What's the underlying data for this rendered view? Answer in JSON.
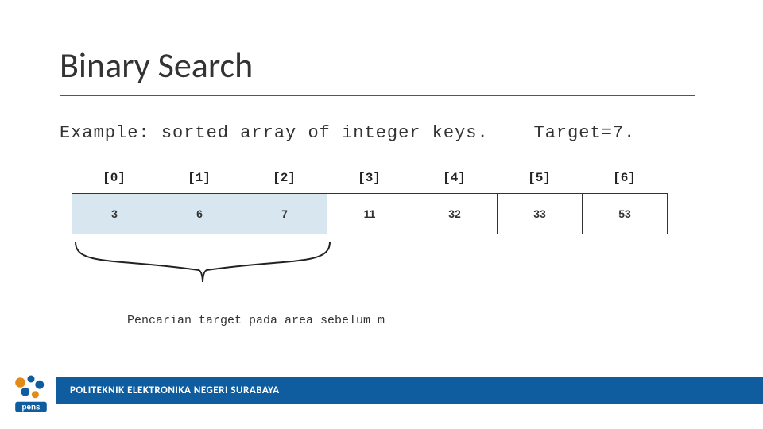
{
  "title": "Binary Search",
  "subtitle_prefix": "Example: sorted array of integer keys.",
  "subtitle_target": "Target=7.",
  "array": {
    "indices": [
      "[0]",
      "[1]",
      "[2]",
      "[3]",
      "[4]",
      "[5]",
      "[6]"
    ],
    "values": [
      "3",
      "6",
      "7",
      "11",
      "32",
      "33",
      "53"
    ],
    "highlighted": [
      true,
      true,
      true,
      false,
      false,
      false,
      false
    ]
  },
  "caption": "Pencarian target pada area sebelum m",
  "footer": "POLITEKNIK ELEKTRONIKA NEGERI SURABAYA",
  "logo_text": "pens",
  "colors": {
    "accent_blue": "#0f5c9e",
    "cell_highlight": "#d8e6ef"
  }
}
